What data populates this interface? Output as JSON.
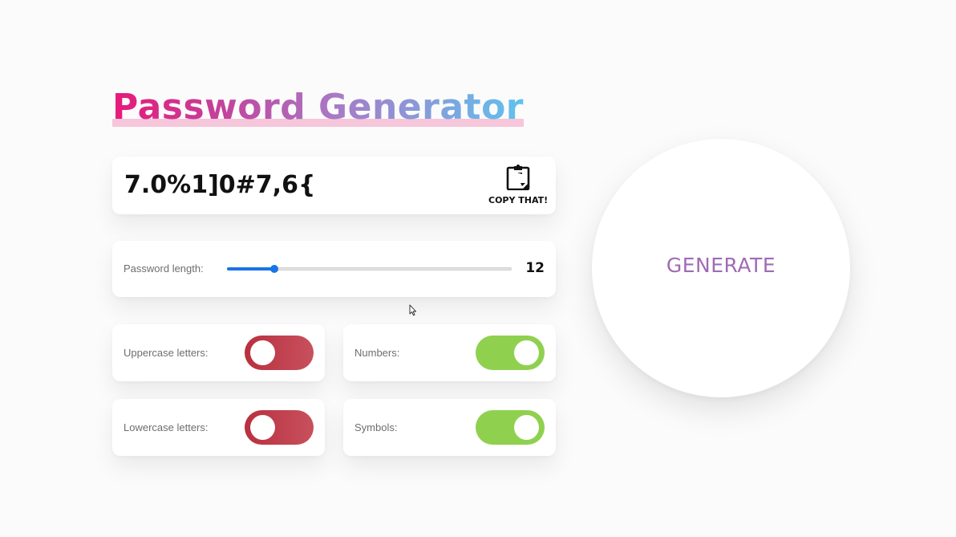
{
  "header": {
    "title": "Password Generator"
  },
  "password": {
    "value": "7.0%1]0#7,6{",
    "copy_label": "COPY THAT!",
    "copy_icon": "clipboard-icon"
  },
  "length": {
    "label": "Password length:",
    "value": "12",
    "slider_fraction": 0.165
  },
  "options": {
    "uppercase": {
      "label": "Uppercase letters:",
      "enabled": false
    },
    "numbers": {
      "label": "Numbers:",
      "enabled": true
    },
    "lowercase": {
      "label": "Lowercase letters:",
      "enabled": false
    },
    "symbols": {
      "label": "Symbols:",
      "enabled": true
    }
  },
  "generate": {
    "label": "GENERATE"
  },
  "colors": {
    "toggle_off": "#b8303f",
    "toggle_on": "#8fd14f",
    "slider_accent": "#1a73e8",
    "generate_text": "#a06bb5",
    "title_gradient_start": "#e8197a",
    "title_gradient_end": "#5fc2ee"
  }
}
